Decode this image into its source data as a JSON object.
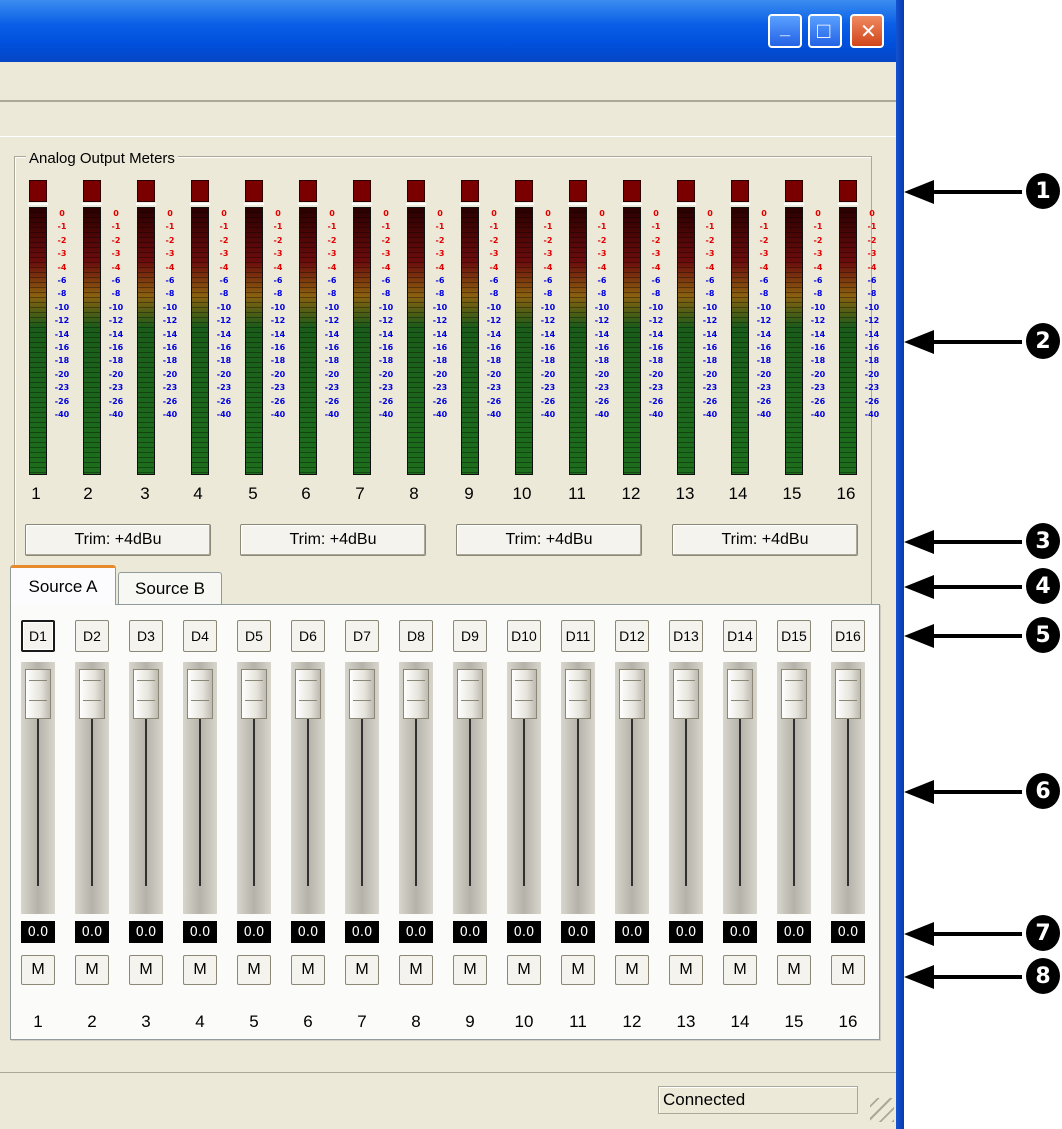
{
  "window": {
    "minimize_glyph": "_",
    "maximize_glyph": "□",
    "close_glyph": "✕"
  },
  "meters": {
    "group_title": "Analog Output Meters",
    "scale_labels": [
      "0",
      "-1",
      "-2",
      "-3",
      "-4",
      "-6",
      "-8",
      "-10",
      "-12",
      "-14",
      "-16",
      "-18",
      "-20",
      "-23",
      "-26",
      "-40"
    ],
    "channel_numbers": [
      "1",
      "2",
      "3",
      "4",
      "5",
      "6",
      "7",
      "8",
      "9",
      "10",
      "11",
      "12",
      "13",
      "14",
      "15",
      "16"
    ]
  },
  "trim_buttons": [
    "Trim: +4dBu",
    "Trim: +4dBu",
    "Trim: +4dBu",
    "Trim: +4dBu"
  ],
  "tabs": [
    "Source A",
    "Source B"
  ],
  "faders": {
    "source_buttons": [
      "D1",
      "D2",
      "D3",
      "D4",
      "D5",
      "D6",
      "D7",
      "D8",
      "D9",
      "D10",
      "D11",
      "D12",
      "D13",
      "D14",
      "D15",
      "D16"
    ],
    "gain_values": [
      "0.0",
      "0.0",
      "0.0",
      "0.0",
      "0.0",
      "0.0",
      "0.0",
      "0.0",
      "0.0",
      "0.0",
      "0.0",
      "0.0",
      "0.0",
      "0.0",
      "0.0",
      "0.0"
    ],
    "mute_label": "M",
    "channel_numbers": [
      "1",
      "2",
      "3",
      "4",
      "5",
      "6",
      "7",
      "8",
      "9",
      "10",
      "11",
      "12",
      "13",
      "14",
      "15",
      "16"
    ]
  },
  "status_bar": {
    "connection": "Connected"
  },
  "callouts": [
    "1",
    "2",
    "3",
    "4",
    "5",
    "6",
    "7",
    "8"
  ]
}
